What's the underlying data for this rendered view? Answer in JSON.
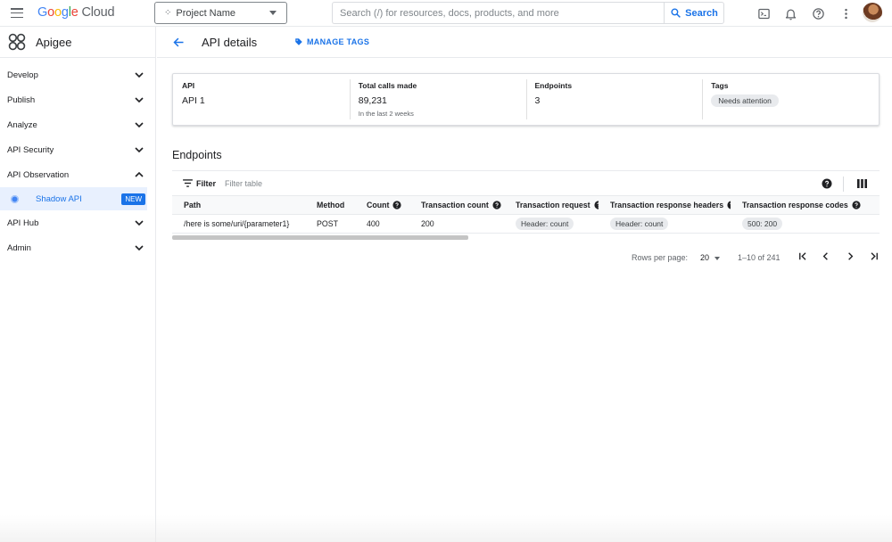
{
  "topbar": {
    "logo_google": [
      "G",
      "o",
      "o",
      "g",
      "l",
      "e"
    ],
    "logo_cloud": "Cloud",
    "project_label": "Project Name",
    "search_placeholder": "Search (/) for resources, docs, products, and more",
    "search_button": "Search"
  },
  "sidebar": {
    "brand": "Apigee",
    "items": [
      {
        "label": "Develop",
        "expanded": false
      },
      {
        "label": "Publish",
        "expanded": false
      },
      {
        "label": "Analyze",
        "expanded": false
      },
      {
        "label": "API Security",
        "expanded": false
      },
      {
        "label": "API Observation",
        "expanded": true
      },
      {
        "label": "API Hub",
        "expanded": false
      },
      {
        "label": "Admin",
        "expanded": false
      }
    ],
    "sub_item": {
      "label": "Shadow API",
      "badge": "NEW"
    }
  },
  "header": {
    "title": "API details",
    "manage_tags": "MANAGE TAGS"
  },
  "summary": {
    "api": {
      "label": "API",
      "value": "API 1"
    },
    "calls": {
      "label": "Total calls made",
      "value": "89,231",
      "sub": "In the last 2 weeks"
    },
    "endpoints": {
      "label": "Endpoints",
      "value": "3"
    },
    "tags": {
      "label": "Tags",
      "chip": "Needs attention"
    }
  },
  "endpoints": {
    "title": "Endpoints",
    "filter_label": "Filter",
    "filter_placeholder": "Filter table",
    "columns": [
      "Path",
      "Method",
      "Count",
      "Transaction count",
      "Transaction request",
      "Transaction response headers",
      "Transaction response codes"
    ],
    "rows": [
      {
        "path": "/here is some/uri/{parameter1}",
        "method": "POST",
        "count": "400",
        "transaction_count": "200",
        "transaction_request": "Header: count",
        "transaction_response_headers": "Header: count",
        "transaction_response_codes": "500: 200"
      }
    ]
  },
  "paginator": {
    "rows_per_page_label": "Rows per page:",
    "rows_per_page_value": "20",
    "range": "1–10 of 241"
  },
  "colors": {
    "accent": "#1a73e8",
    "selected_bg": "#e8f0fe",
    "border": "#dadce0",
    "chip_bg": "#e8eaed"
  },
  "icons": {
    "menu": "hamburger-icon",
    "project": "project-dots-icon",
    "search": "search-icon",
    "terminal": "terminal-icon",
    "notifications": "bell-icon",
    "help": "help-icon",
    "more": "more-vert-icon",
    "tag": "tag-icon",
    "back": "arrow-back-icon",
    "filter": "filter-icon",
    "columns": "columns-icon"
  }
}
